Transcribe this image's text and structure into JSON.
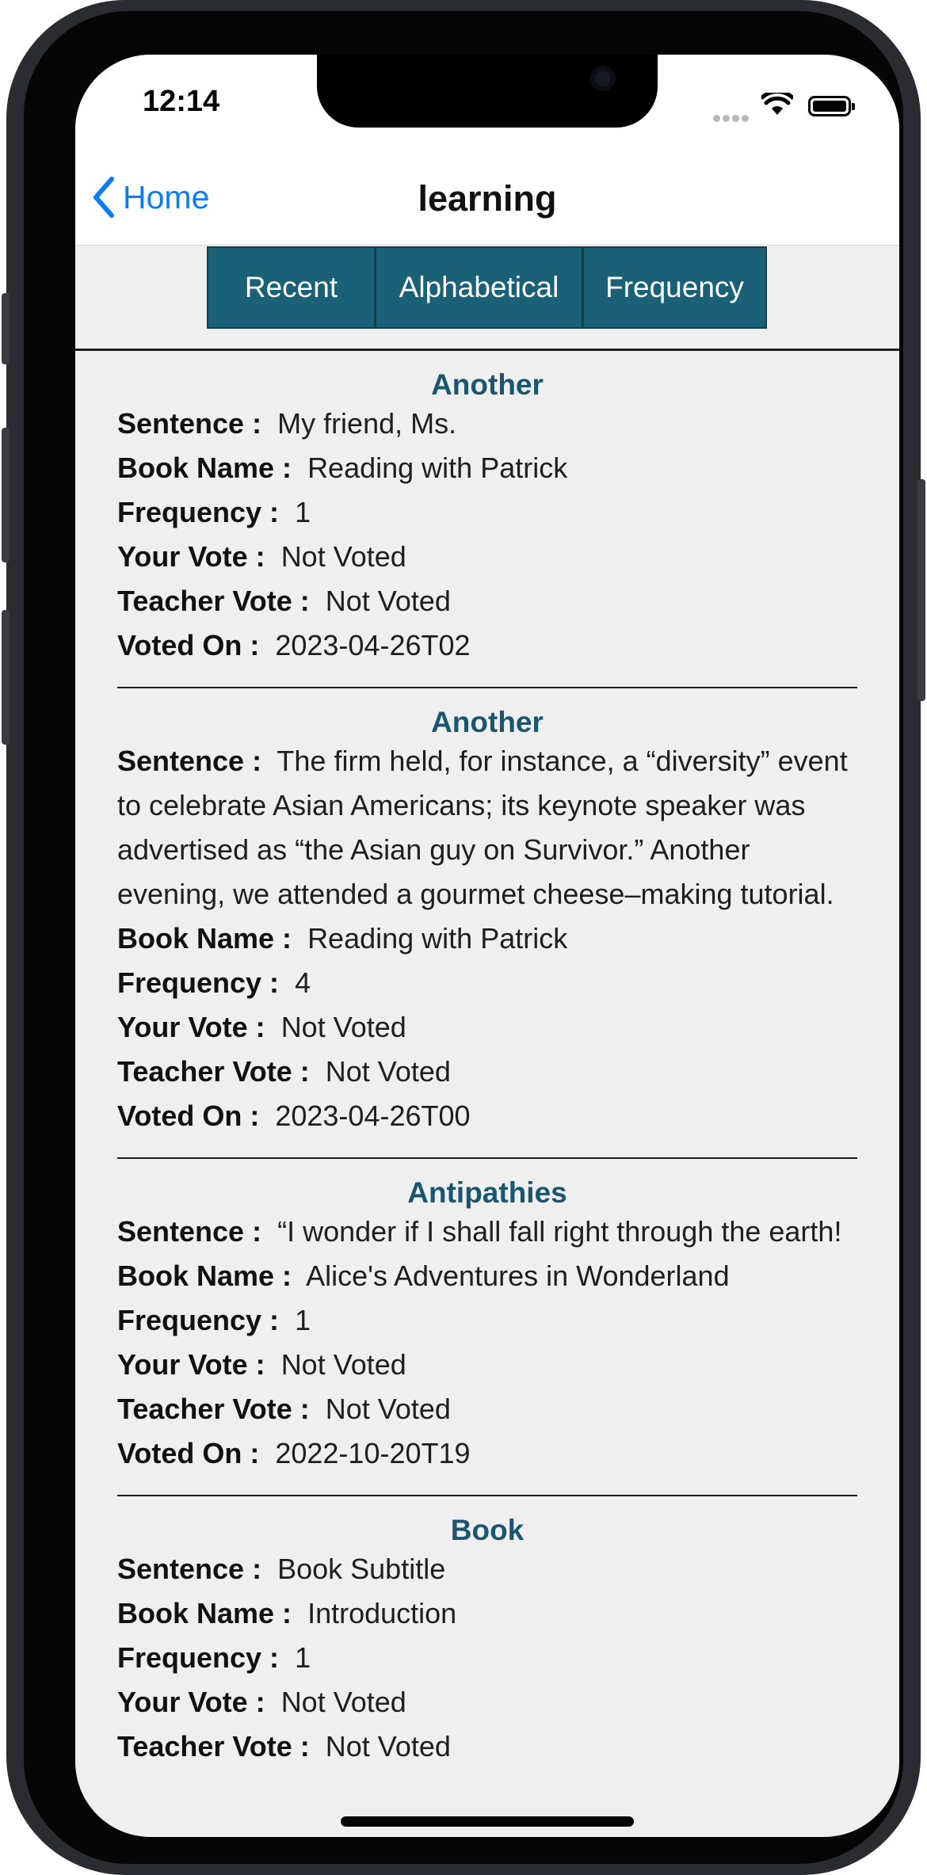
{
  "status_bar": {
    "time": "12:14"
  },
  "nav": {
    "back_label": "Home",
    "title": "learning"
  },
  "sort_tabs": [
    {
      "label": "Recent"
    },
    {
      "label": "Alphabetical"
    },
    {
      "label": "Frequency"
    }
  ],
  "labels": {
    "sentence": "Sentence :",
    "book_name": "Book Name :",
    "frequency": "Frequency :",
    "your_vote": "Your Vote :",
    "teacher_vote": "Teacher Vote :",
    "voted_on": "Voted On :"
  },
  "entries": [
    {
      "word": "Another",
      "sentence": "My friend, Ms.",
      "book_name": "Reading with Patrick",
      "frequency": "1",
      "your_vote": "Not Voted",
      "teacher_vote": "Not Voted",
      "voted_on": "2023-04-26T02"
    },
    {
      "word": "Another",
      "sentence": "The firm held, for instance, a “diversity” event to celebrate Asian Americans; its keynote speaker was advertised as “the Asian guy on Survivor.” Another evening, we attended a gourmet cheese–making tutorial.",
      "book_name": "Reading with Patrick",
      "frequency": "4",
      "your_vote": "Not Voted",
      "teacher_vote": "Not Voted",
      "voted_on": "2023-04-26T00"
    },
    {
      "word": "Antipathies",
      "sentence": "“I wonder if I shall fall right through the earth!",
      "book_name": "Alice's Adventures in Wonderland",
      "frequency": "1",
      "your_vote": "Not Voted",
      "teacher_vote": "Not Voted",
      "voted_on": "2022-10-20T19"
    },
    {
      "word": "Book",
      "sentence": "Book Subtitle",
      "book_name": "Introduction",
      "frequency": "1",
      "your_vote": "Not Voted",
      "teacher_vote": "Not Voted",
      "voted_on": ""
    }
  ],
  "colors": {
    "accent": "#0a7cf5",
    "segment_bg": "#1a6178",
    "word_title": "#1a5670",
    "screen_bg": "#efefef"
  },
  "icons": {
    "back": "chevron-left-icon",
    "wifi": "wifi-icon",
    "battery": "battery-icon",
    "signal": "signal-icon"
  }
}
